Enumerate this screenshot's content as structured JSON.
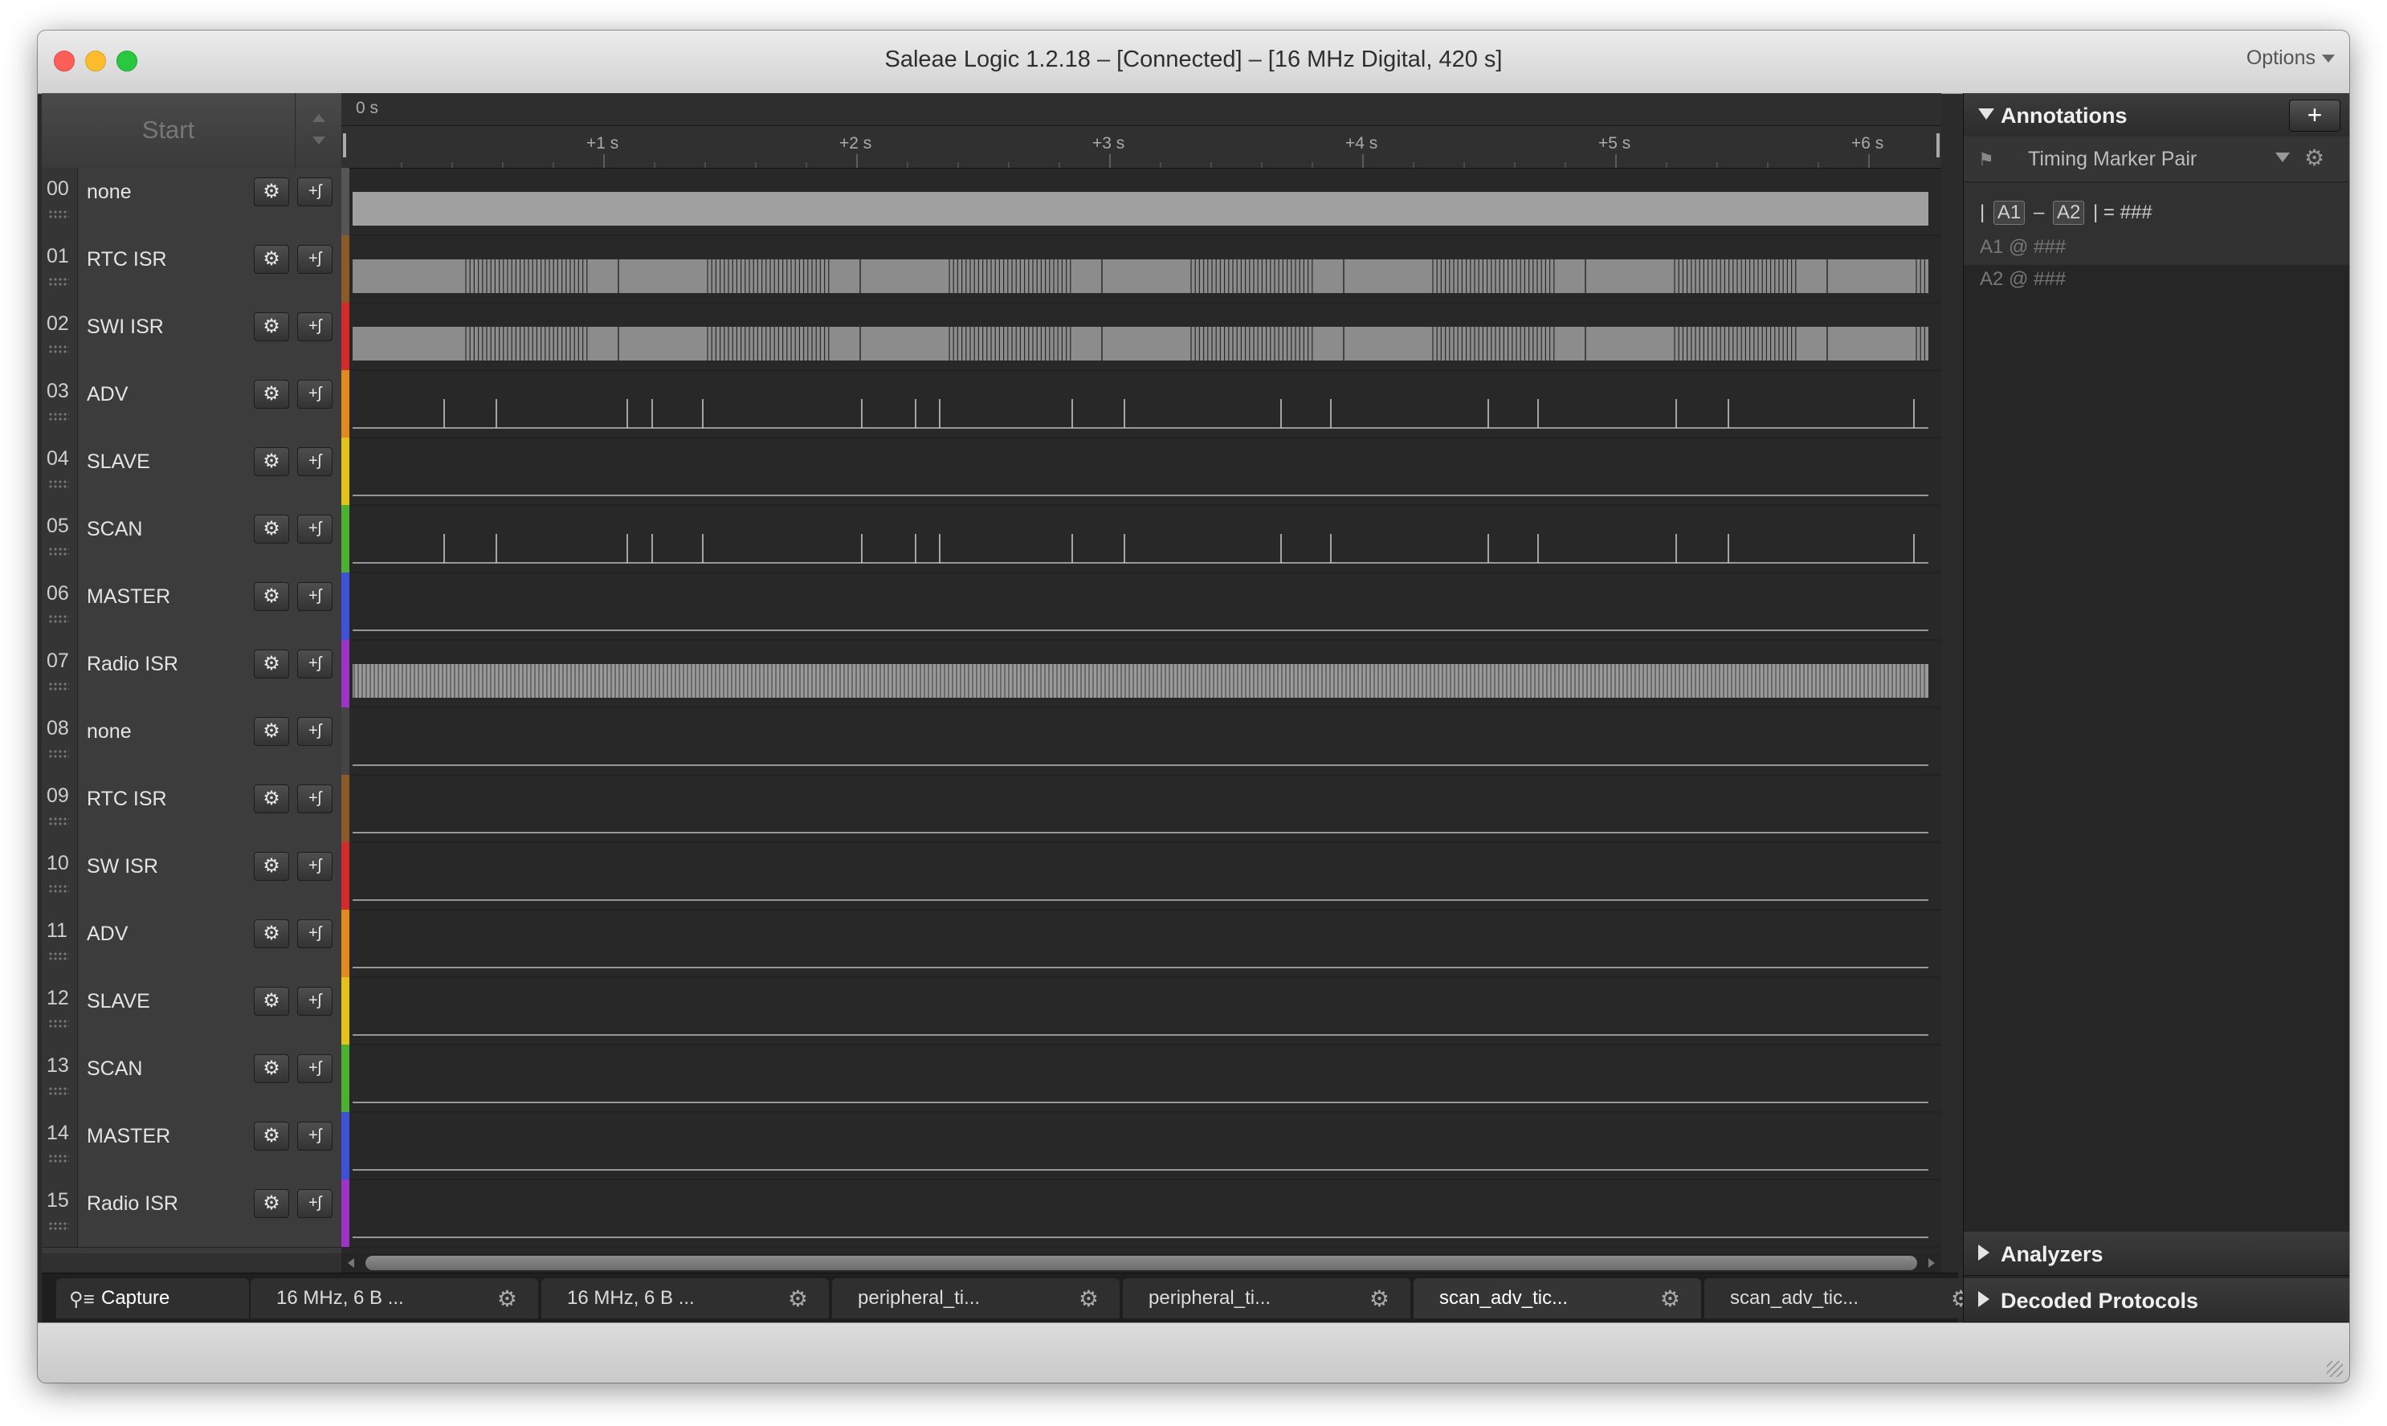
{
  "window": {
    "title": "Saleae Logic 1.2.18 – [Connected] – [16 MHz Digital, 420 s]",
    "options_label": "Options"
  },
  "capture_panel": {
    "start_label": "Start"
  },
  "channels": [
    {
      "num": "00",
      "name": "none",
      "color": "#555555"
    },
    {
      "num": "01",
      "name": "RTC ISR",
      "color": "#8b5a2b"
    },
    {
      "num": "02",
      "name": "SWI ISR",
      "color": "#d42a2a"
    },
    {
      "num": "03",
      "name": "ADV",
      "color": "#e08a1e"
    },
    {
      "num": "04",
      "name": "SLAVE",
      "color": "#e3c21a"
    },
    {
      "num": "05",
      "name": "SCAN",
      "color": "#4caf30"
    },
    {
      "num": "06",
      "name": "MASTER",
      "color": "#3f51d8"
    },
    {
      "num": "07",
      "name": "Radio ISR",
      "color": "#9b35c8"
    },
    {
      "num": "08",
      "name": "none",
      "color": "#444444"
    },
    {
      "num": "09",
      "name": "RTC ISR",
      "color": "#8b5a2b"
    },
    {
      "num": "10",
      "name": "SW ISR",
      "color": "#d42a2a"
    },
    {
      "num": "11",
      "name": "ADV",
      "color": "#e08a1e"
    },
    {
      "num": "12",
      "name": "SLAVE",
      "color": "#e3c21a"
    },
    {
      "num": "13",
      "name": "SCAN",
      "color": "#4caf30"
    },
    {
      "num": "14",
      "name": "MASTER",
      "color": "#3f51d8"
    },
    {
      "num": "15",
      "name": "Radio ISR",
      "color": "#9b35c8"
    }
  ],
  "timeline": {
    "zero_label": "0 s",
    "ticks": [
      "+1 s",
      "+2 s",
      "+3 s",
      "+4 s",
      "+5 s",
      "+6 s"
    ]
  },
  "tabs": [
    {
      "label": "Capture",
      "active": false,
      "icon": "magnifier-icon"
    },
    {
      "label": "16 MHz, 6 B ...",
      "active": false
    },
    {
      "label": "16 MHz, 6 B ...",
      "active": false
    },
    {
      "label": "peripheral_ti...",
      "active": false
    },
    {
      "label": "peripheral_ti...",
      "active": false
    },
    {
      "label": "scan_adv_tic...",
      "active": true
    },
    {
      "label": "scan_adv_tic...",
      "active": false
    }
  ],
  "annotations": {
    "section_label": "Annotations",
    "add_label": "+",
    "marker_pair_label": "Timing Marker Pair",
    "formula_open": "|",
    "a1": "A1",
    "minus": "–",
    "a2": "A2",
    "formula_close": "| = ###",
    "a1_row": "A1  @  ###",
    "a2_row": "A2  @  ###"
  },
  "analyzers_label": "Analyzers",
  "decoded_protocols_label": "Decoded Protocols"
}
